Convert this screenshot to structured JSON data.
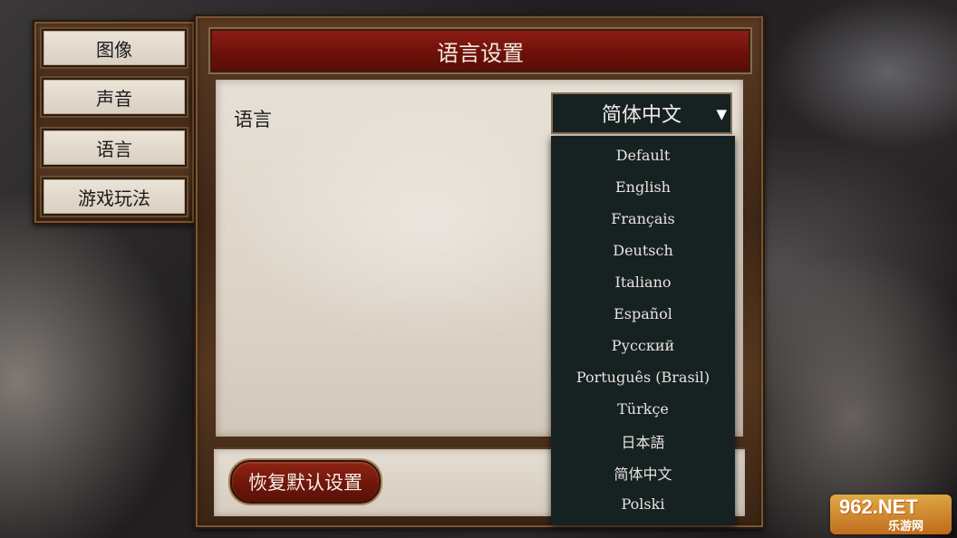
{
  "sidebar": {
    "items": [
      {
        "label": "图像"
      },
      {
        "label": "声音"
      },
      {
        "label": "语言"
      },
      {
        "label": "游戏玩法"
      }
    ]
  },
  "panel": {
    "title": "语言设置",
    "language_label": "语言",
    "reset_button": "恢复默认设置"
  },
  "language_select": {
    "selected": "简体中文",
    "arrow_icon": "dropdown-arrow-icon",
    "options": [
      "Default",
      "English",
      "Français",
      "Deutsch",
      "Italiano",
      "Español",
      "Русский",
      "Português (Brasil)",
      "Türkçe",
      "日本語",
      "简体中文",
      "Polski"
    ]
  },
  "watermark": {
    "brand": "962.NET",
    "subtitle": "乐游网"
  },
  "colors": {
    "title_bar": "#6d1109",
    "dropdown_bg": "#162122",
    "paper": "#e2dbd0",
    "reset_button": "#7a1a0e"
  }
}
